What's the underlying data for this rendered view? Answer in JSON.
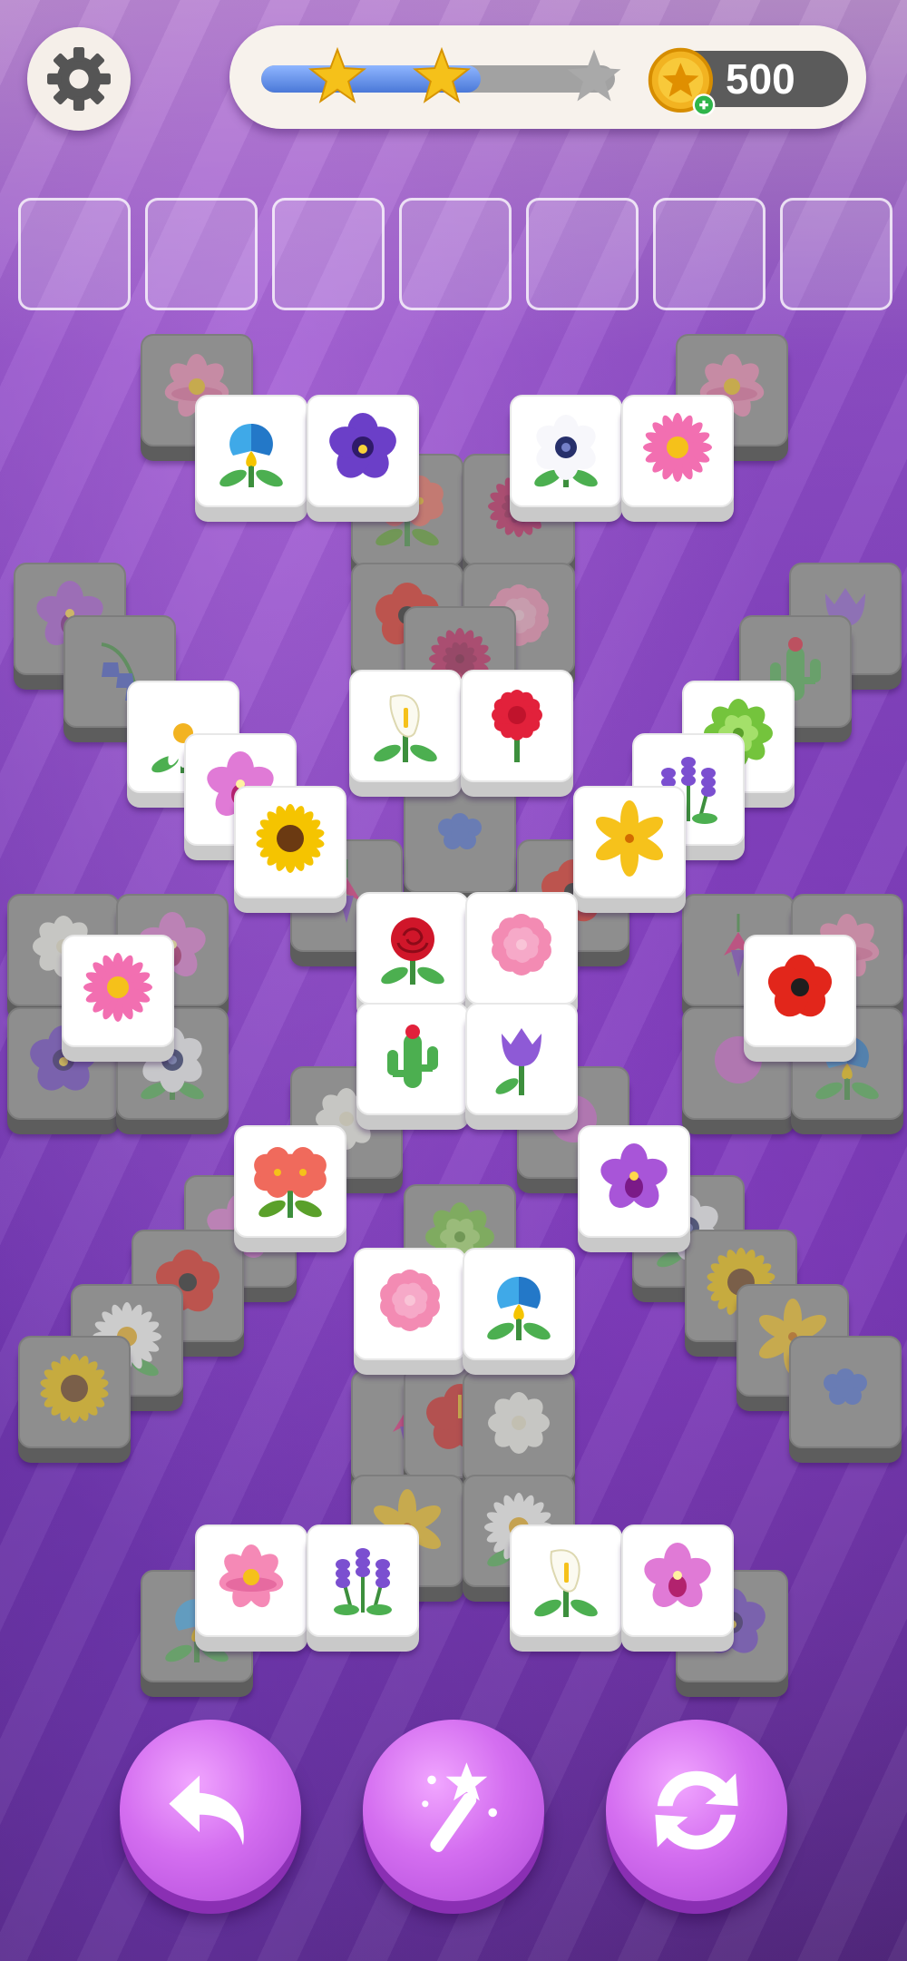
{
  "hud": {
    "settings_icon": "gear-icon",
    "progress": 0.62,
    "stars_earned": 2,
    "stars_total": 3,
    "coins": "500",
    "coin_icon": "coin-star-icon",
    "coin_add_icon": "plus-icon"
  },
  "collection_slots": {
    "count": 7,
    "filled": 0
  },
  "colors": {
    "tile_face": "#ffffff",
    "tile_locked": "#8e8e8e",
    "button_purple": "#d46ef0",
    "progress_blue": "#4a78d8",
    "star_gold": "#f5c11a",
    "coin_gold": "#f2b321",
    "coin_plus_green": "#2fb54a"
  },
  "tiles_free": [
    {
      "flower": "blue-iris"
    },
    {
      "flower": "purple-pansy"
    },
    {
      "flower": "white-anemone"
    },
    {
      "flower": "pink-daisy"
    },
    {
      "flower": "white-daisy"
    },
    {
      "flower": "pink-orchid"
    },
    {
      "flower": "calla-lily"
    },
    {
      "flower": "red-carnation"
    },
    {
      "flower": "green-succulent"
    },
    {
      "flower": "purple-lavender"
    },
    {
      "flower": "sunflower"
    },
    {
      "flower": "yellow-lily"
    },
    {
      "flower": "pink-daisy"
    },
    {
      "flower": "red-rose"
    },
    {
      "flower": "pink-peony"
    },
    {
      "flower": "red-poppy"
    },
    {
      "flower": "cactus"
    },
    {
      "flower": "purple-tulip"
    },
    {
      "flower": "red-begonia"
    },
    {
      "flower": "purple-orchid"
    },
    {
      "flower": "pink-peony"
    },
    {
      "flower": "blue-iris"
    },
    {
      "flower": "pink-lotus"
    },
    {
      "flower": "purple-lavender"
    },
    {
      "flower": "calla-lily"
    },
    {
      "flower": "pink-orchid"
    }
  ],
  "buttons": {
    "undo_icon": "undo-icon",
    "magic_icon": "magic-wand-icon",
    "shuffle_icon": "shuffle-icon"
  }
}
